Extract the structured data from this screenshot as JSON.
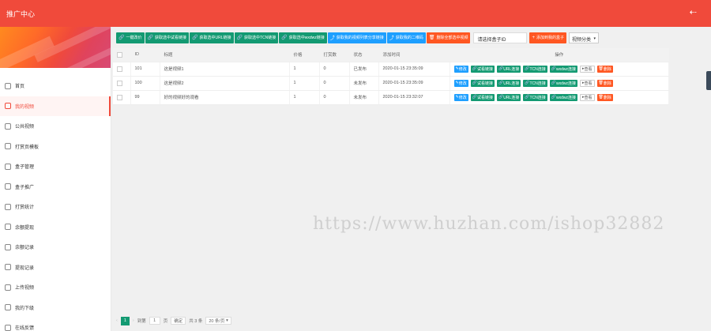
{
  "app": {
    "title": "推广中心",
    "back_icon": "arrow-left-icon"
  },
  "sidebar": {
    "items": [
      {
        "label": "首页",
        "icon": "home-icon",
        "active": false
      },
      {
        "label": "我的视频",
        "icon": "video-icon",
        "active": true
      },
      {
        "label": "公共视频",
        "icon": "star-icon",
        "active": false
      },
      {
        "label": "打赏页模板",
        "icon": "template-icon",
        "active": false
      },
      {
        "label": "盒子管理",
        "icon": "box-icon",
        "active": false
      },
      {
        "label": "盒子推广",
        "icon": "share-icon",
        "active": false
      },
      {
        "label": "打赏统计",
        "icon": "stats-icon",
        "active": false
      },
      {
        "label": "余额提现",
        "icon": "wallet-icon",
        "active": false
      },
      {
        "label": "余额记录",
        "icon": "record-icon",
        "active": false
      },
      {
        "label": "提现记录",
        "icon": "withdraw-icon",
        "active": false
      },
      {
        "label": "上传视频",
        "icon": "upload-icon",
        "active": false
      },
      {
        "label": "我的下级",
        "icon": "users-icon",
        "active": false
      },
      {
        "label": "在线反馈",
        "icon": "feedback-icon",
        "active": false
      }
    ]
  },
  "toolbar": {
    "buttons": [
      {
        "label": "一键改价",
        "color": "green"
      },
      {
        "label": "获取选中试看链接",
        "color": "green"
      },
      {
        "label": "获取选中URL链接",
        "color": "green"
      },
      {
        "label": "获取选中TCN链接",
        "color": "green"
      },
      {
        "label": "获取选中wxdwz链接",
        "color": "green"
      },
      {
        "label": "获取我的视频列表分享链接",
        "color": "blue"
      },
      {
        "label": "获取我的二维码",
        "color": "blue"
      },
      {
        "label": "删除全部选中视频",
        "color": "orange"
      }
    ],
    "search_value": "请选择盒子ID",
    "add_button": "添加到我的盒子",
    "category_select": "视频分类"
  },
  "table": {
    "headers": [
      "ID",
      "标题",
      "价格",
      "打赏数",
      "状态",
      "添加时间",
      "操作"
    ],
    "rows": [
      {
        "id": "101",
        "title": "这是视频1",
        "price": "1",
        "rewards": "0",
        "status": "已发布",
        "time": "2020-01-15 23:35:09"
      },
      {
        "id": "100",
        "title": "这是视频2",
        "price": "1",
        "rewards": "0",
        "status": "未发布",
        "time": "2020-01-15 23:35:09"
      },
      {
        "id": "99",
        "title": "好的视频好的观看",
        "price": "1",
        "rewards": "0",
        "status": "未发布",
        "time": "2020-01-15 23:32:07"
      }
    ],
    "row_actions": [
      {
        "label": "修改",
        "color": "blue"
      },
      {
        "label": "试看链接",
        "color": "green"
      },
      {
        "label": "URL连接",
        "color": "green"
      },
      {
        "label": "TCN连接",
        "color": "green"
      },
      {
        "label": "wxdwz连接",
        "color": "green"
      },
      {
        "label": "查看",
        "color": "plain"
      },
      {
        "label": "删除",
        "color": "orange"
      }
    ]
  },
  "watermark": "https://www.huzhan.com/ishop32882",
  "pager": {
    "current": "1",
    "goto_label": "到第",
    "goto_value": "1",
    "page_unit": "页",
    "confirm": "确定",
    "total": "共 3 条",
    "page_size": "20 条/页"
  }
}
